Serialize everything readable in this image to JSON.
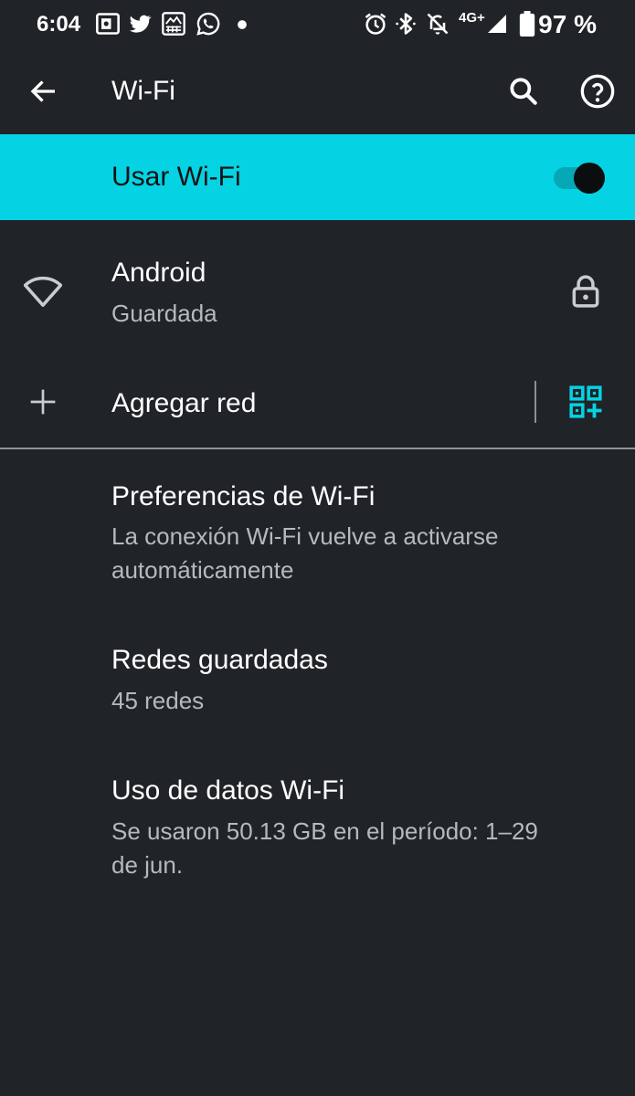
{
  "status_bar": {
    "time": "6:04",
    "battery_text": "97 %",
    "network_label": "4G+",
    "left_icons": [
      "outlook-icon",
      "twitter-icon",
      "news-app-icon",
      "whatsapp-icon",
      "dot-icon"
    ],
    "right_icons": [
      "alarm-icon",
      "bluetooth-icon",
      "notifications-off-icon",
      "signal-icon",
      "battery-icon"
    ]
  },
  "app_bar": {
    "title": "Wi-Fi",
    "back_icon": "arrow-back-icon",
    "search_icon": "search-icon",
    "help_icon": "help-icon"
  },
  "wifi_toggle": {
    "label": "Usar Wi-Fi",
    "enabled": true,
    "background": "#05d3e3"
  },
  "networks": [
    {
      "name": "Android",
      "status": "Guardada",
      "icon": "wifi-icon",
      "secured": true
    }
  ],
  "add_network": {
    "label": "Agregar red",
    "icon": "plus-icon",
    "qr_icon": "qr-code-add-icon",
    "accent": "#05d3e3"
  },
  "settings": [
    {
      "title": "Preferencias de Wi-Fi",
      "summary_lines": [
        "La conexión Wi-Fi vuelve a activarse",
        "automáticamente"
      ]
    },
    {
      "title": "Redes guardadas",
      "summary_lines": [
        "45 redes"
      ]
    },
    {
      "title": "Uso de datos Wi-Fi",
      "summary_lines": [
        "Se usaron 50.13 GB en el período: 1–29",
        "de jun."
      ]
    }
  ],
  "colors": {
    "background": "#202327",
    "accent": "#05d3e3",
    "primary_text": "#ffffff",
    "secondary_text": "#b6b9bd"
  }
}
